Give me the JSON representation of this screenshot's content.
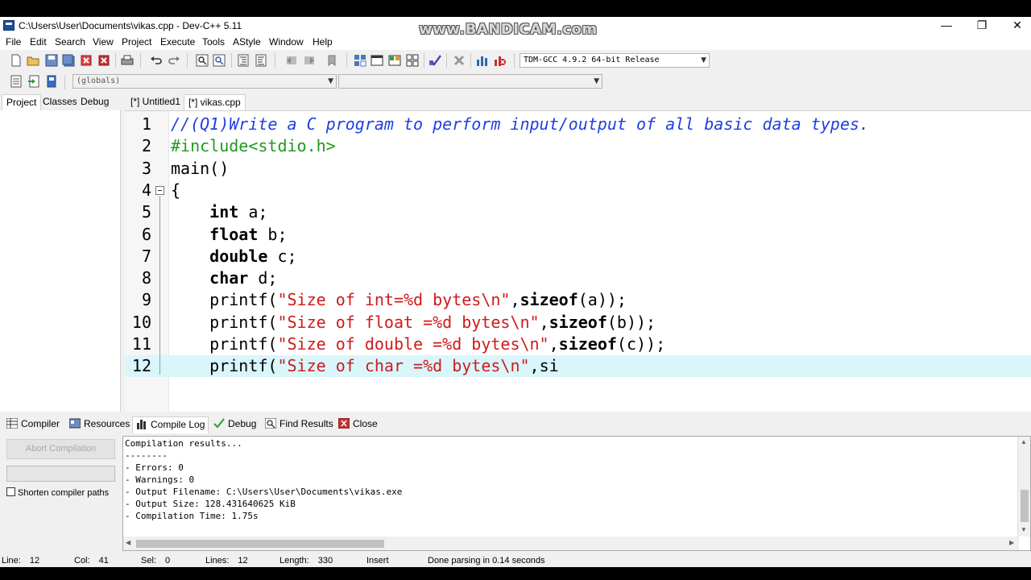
{
  "window": {
    "title": "C:\\Users\\User\\Documents\\vikas.cpp - Dev-C++ 5.11",
    "watermark": "www.BANDICAM.com",
    "minimize_glyph": "—",
    "maximize_glyph": "❐",
    "close_glyph": "✕"
  },
  "menu": {
    "items": [
      "File",
      "Edit",
      "Search",
      "View",
      "Project",
      "Execute",
      "Tools",
      "AStyle",
      "Window",
      "Help"
    ]
  },
  "toolbar": {
    "compiler_select": "TDM-GCC 4.9.2 64-bit Release",
    "scope_select": "(globals)",
    "symbol_select": ""
  },
  "left_panel": {
    "tabs": [
      "Project",
      "Classes",
      "Debug"
    ]
  },
  "editor": {
    "tabs": [
      "[*] Untitled1",
      "[*] vikas.cpp"
    ],
    "current_line": 12,
    "lines": [
      {
        "n": "1",
        "tokens": [
          {
            "t": "//(Q1)Write a C program to perform input/output of all basic data types.",
            "c": "comment"
          }
        ]
      },
      {
        "n": "2",
        "tokens": [
          {
            "t": "#include<stdio.h>",
            "c": "pre"
          }
        ]
      },
      {
        "n": "3",
        "tokens": [
          {
            "t": "main()",
            "c": "plain"
          }
        ]
      },
      {
        "n": "4",
        "tokens": [
          {
            "t": "{",
            "c": "plain"
          }
        ]
      },
      {
        "n": "5",
        "tokens": [
          {
            "t": "    ",
            "c": "plain"
          },
          {
            "t": "int",
            "c": "kw"
          },
          {
            "t": " a;",
            "c": "plain"
          }
        ]
      },
      {
        "n": "6",
        "tokens": [
          {
            "t": "    ",
            "c": "plain"
          },
          {
            "t": "float",
            "c": "kw"
          },
          {
            "t": " b;",
            "c": "plain"
          }
        ]
      },
      {
        "n": "7",
        "tokens": [
          {
            "t": "    ",
            "c": "plain"
          },
          {
            "t": "double",
            "c": "kw"
          },
          {
            "t": " c;",
            "c": "plain"
          }
        ]
      },
      {
        "n": "8",
        "tokens": [
          {
            "t": "    ",
            "c": "plain"
          },
          {
            "t": "char",
            "c": "kw"
          },
          {
            "t": " d;",
            "c": "plain"
          }
        ]
      },
      {
        "n": "9",
        "tokens": [
          {
            "t": "    printf(",
            "c": "plain"
          },
          {
            "t": "\"Size of int=%d bytes\\n\"",
            "c": "str"
          },
          {
            "t": ",",
            "c": "plain"
          },
          {
            "t": "sizeof",
            "c": "kw"
          },
          {
            "t": "(a));",
            "c": "plain"
          }
        ]
      },
      {
        "n": "10",
        "tokens": [
          {
            "t": "    printf(",
            "c": "plain"
          },
          {
            "t": "\"Size of float =%d bytes\\n\"",
            "c": "str"
          },
          {
            "t": ",",
            "c": "plain"
          },
          {
            "t": "sizeof",
            "c": "kw"
          },
          {
            "t": "(b));",
            "c": "plain"
          }
        ]
      },
      {
        "n": "11",
        "tokens": [
          {
            "t": "    printf(",
            "c": "plain"
          },
          {
            "t": "\"Size of double =%d bytes\\n\"",
            "c": "str"
          },
          {
            "t": ",",
            "c": "plain"
          },
          {
            "t": "sizeof",
            "c": "kw"
          },
          {
            "t": "(c));",
            "c": "plain"
          }
        ]
      },
      {
        "n": "12",
        "tokens": [
          {
            "t": "    printf(",
            "c": "plain"
          },
          {
            "t": "\"Size of char =%d bytes\\n\"",
            "c": "str"
          },
          {
            "t": ",si",
            "c": "plain"
          }
        ]
      }
    ]
  },
  "bottom_panel": {
    "tabs": [
      "Compiler",
      "Resources",
      "Compile Log",
      "Debug",
      "Find Results",
      "Close"
    ],
    "active_tab": "Compile Log",
    "abort_button": "Abort Compilation",
    "shorten_paths_label": "Shorten compiler paths",
    "log_lines": [
      "Compilation results...",
      "--------",
      "- Errors: 0",
      "- Warnings: 0",
      "- Output Filename: C:\\Users\\User\\Documents\\vikas.exe",
      "- Output Size: 128.431640625 KiB",
      "- Compilation Time: 1.75s"
    ]
  },
  "statusbar": {
    "line_label": "Line:",
    "line_value": "12",
    "col_label": "Col:",
    "col_value": "41",
    "sel_label": "Sel:",
    "sel_value": "0",
    "lines_label": "Lines:",
    "lines_value": "12",
    "length_label": "Length:",
    "length_value": "330",
    "mode": "Insert",
    "message": "Done parsing in 0.14 seconds"
  },
  "colors": {
    "comment": "#1f3fe0",
    "preprocessor": "#1f9a1f",
    "string": "#d01a1a",
    "current_line_bg": "#d9f6fb"
  }
}
